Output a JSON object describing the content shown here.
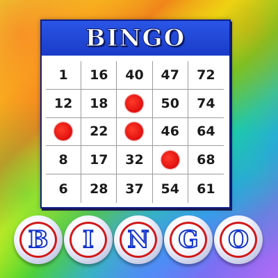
{
  "card": {
    "title": "BINGO",
    "rows": [
      [
        "1",
        "16",
        "40",
        "47",
        "72"
      ],
      [
        "12",
        "18",
        "",
        "50",
        "74"
      ],
      [
        "",
        "22",
        "",
        "46",
        "64"
      ],
      [
        "8",
        "17",
        "32",
        "",
        "68"
      ],
      [
        "6",
        "28",
        "37",
        "54",
        "61"
      ]
    ],
    "marked": [
      [
        1,
        2
      ],
      [
        2,
        0
      ],
      [
        2,
        2
      ],
      [
        3,
        3
      ]
    ],
    "dauber_color": "#e01010",
    "header_color": "#1f46d8"
  },
  "balls": [
    "B",
    "I",
    "N",
    "G",
    "O"
  ]
}
